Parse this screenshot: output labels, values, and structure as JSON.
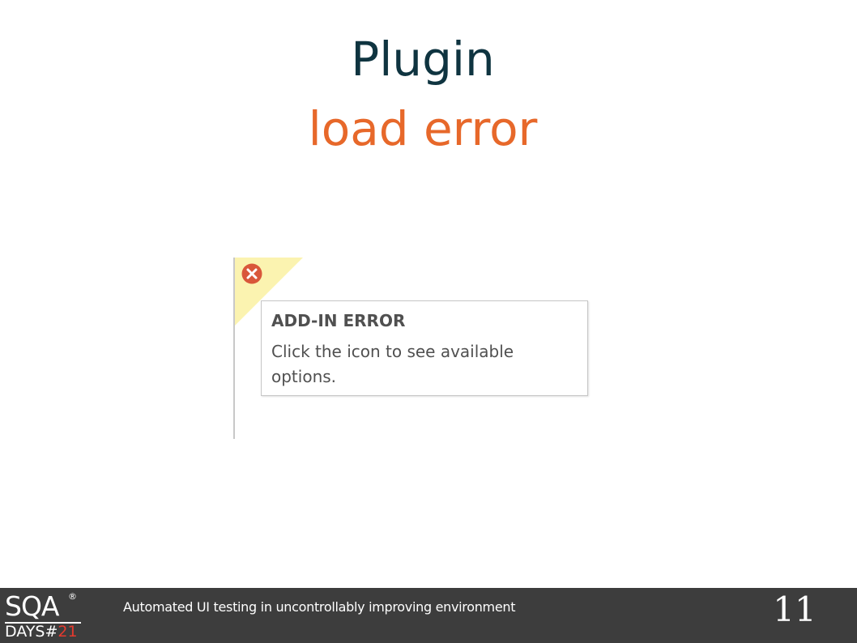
{
  "slide": {
    "title_line1": "Plugin",
    "title_line2": "load error",
    "title_color": "#0f3440",
    "accent_color": "#e7682a"
  },
  "addin_error": {
    "icon": "error-circle-x-icon",
    "flag_color": "#fbf3b0",
    "heading": "ADD-IN ERROR",
    "message": "Click the icon to see available options."
  },
  "footer": {
    "logo": {
      "brand": "SQA",
      "registered": "®",
      "days_label": "DAYS",
      "hash": "#",
      "number": "21",
      "number_color": "#e53a2e"
    },
    "caption": "Automated UI testing in uncontrollably improving environment",
    "slide_number": "11",
    "background": "#3d3d3d"
  }
}
